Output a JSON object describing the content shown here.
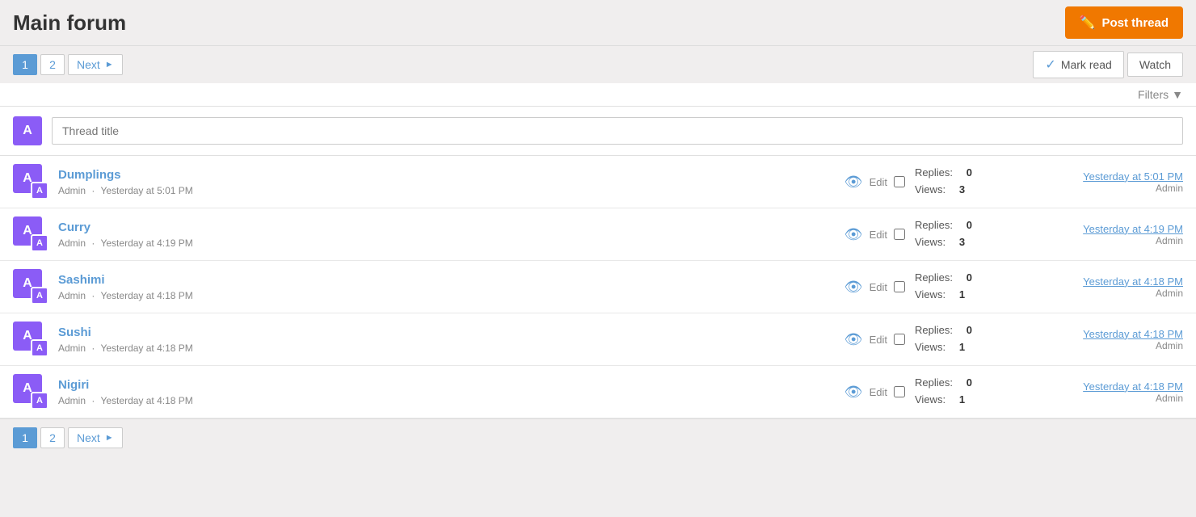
{
  "header": {
    "title": "Main forum",
    "post_thread_label": "Post thread"
  },
  "pagination_top": {
    "page1": "1",
    "page2": "2",
    "next_label": "Next"
  },
  "pagination_bottom": {
    "page1": "1",
    "page2": "2",
    "next_label": "Next"
  },
  "toolbar": {
    "mark_read_label": "Mark read",
    "watch_label": "Watch",
    "filters_label": "Filters"
  },
  "new_thread": {
    "placeholder": "Thread title",
    "avatar_letter": "A"
  },
  "threads": [
    {
      "id": 1,
      "title": "Dumplings",
      "author": "Admin",
      "timestamp": "Yesterday at 5:01 PM",
      "replies": 0,
      "views": 3,
      "last_post_time": "Yesterday at 5:01 PM",
      "last_post_user": "Admin",
      "avatar_letter": "A",
      "sub_avatar_letter": "A"
    },
    {
      "id": 2,
      "title": "Curry",
      "author": "Admin",
      "timestamp": "Yesterday at 4:19 PM",
      "replies": 0,
      "views": 3,
      "last_post_time": "Yesterday at 4:19 PM",
      "last_post_user": "Admin",
      "avatar_letter": "A",
      "sub_avatar_letter": "A"
    },
    {
      "id": 3,
      "title": "Sashimi",
      "author": "Admin",
      "timestamp": "Yesterday at 4:18 PM",
      "replies": 0,
      "views": 1,
      "last_post_time": "Yesterday at 4:18 PM",
      "last_post_user": "Admin",
      "avatar_letter": "A",
      "sub_avatar_letter": "A"
    },
    {
      "id": 4,
      "title": "Sushi",
      "author": "Admin",
      "timestamp": "Yesterday at 4:18 PM",
      "replies": 0,
      "views": 1,
      "last_post_time": "Yesterday at 4:18 PM",
      "last_post_user": "Admin",
      "avatar_letter": "A",
      "sub_avatar_letter": "A"
    },
    {
      "id": 5,
      "title": "Nigiri",
      "author": "Admin",
      "timestamp": "Yesterday at 4:18 PM",
      "replies": 0,
      "views": 1,
      "last_post_time": "Yesterday at 4:18 PM",
      "last_post_user": "Admin",
      "avatar_letter": "A",
      "sub_avatar_letter": "A"
    }
  ],
  "labels": {
    "replies": "Replies:",
    "views": "Views:",
    "edit": "Edit",
    "dot": "·"
  }
}
